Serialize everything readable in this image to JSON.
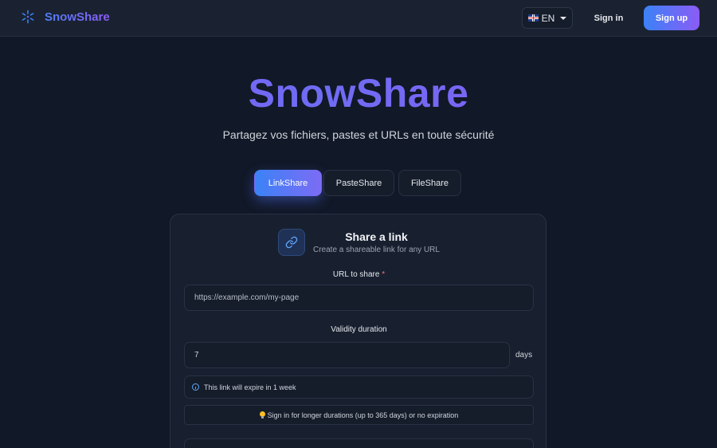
{
  "navbar": {
    "brand_name": "SnowShare",
    "brand_icon": "snowflake-icon",
    "language": {
      "flag_icon": "uk-flag-icon",
      "label": "EN",
      "caret_icon": "chevron-down-icon"
    },
    "signin_label": "Sign in",
    "signup_label": "Sign up"
  },
  "hero": {
    "title": "SnowShare",
    "subtitle": "Partagez vos fichiers, pastes et URLs en toute sécurité"
  },
  "tabs": [
    {
      "label": "LinkShare",
      "active": true
    },
    {
      "label": "PasteShare",
      "active": false
    },
    {
      "label": "FileShare",
      "active": false
    }
  ],
  "card": {
    "icon": "link-icon",
    "title": "Share a link",
    "subtitle": "Create a shareable link for any URL",
    "url_field": {
      "label": "URL to share",
      "required_mark": "*",
      "placeholder": "https://example.com/my-page",
      "value": ""
    },
    "duration_field": {
      "label": "Validity duration",
      "value": "7",
      "unit": "days"
    },
    "expire_note": {
      "icon": "info-icon",
      "text": "This link will expire in 1 week"
    },
    "tip": {
      "icon": "lightbulb-icon",
      "text": "Sign in for longer durations (up to 365 days) or no expiration"
    }
  },
  "colors": {
    "background": "#111827",
    "navbar": "#1a2231",
    "card": "#182030",
    "accent_blue": "#3b82f6",
    "accent_purple": "#8b5cf6"
  }
}
